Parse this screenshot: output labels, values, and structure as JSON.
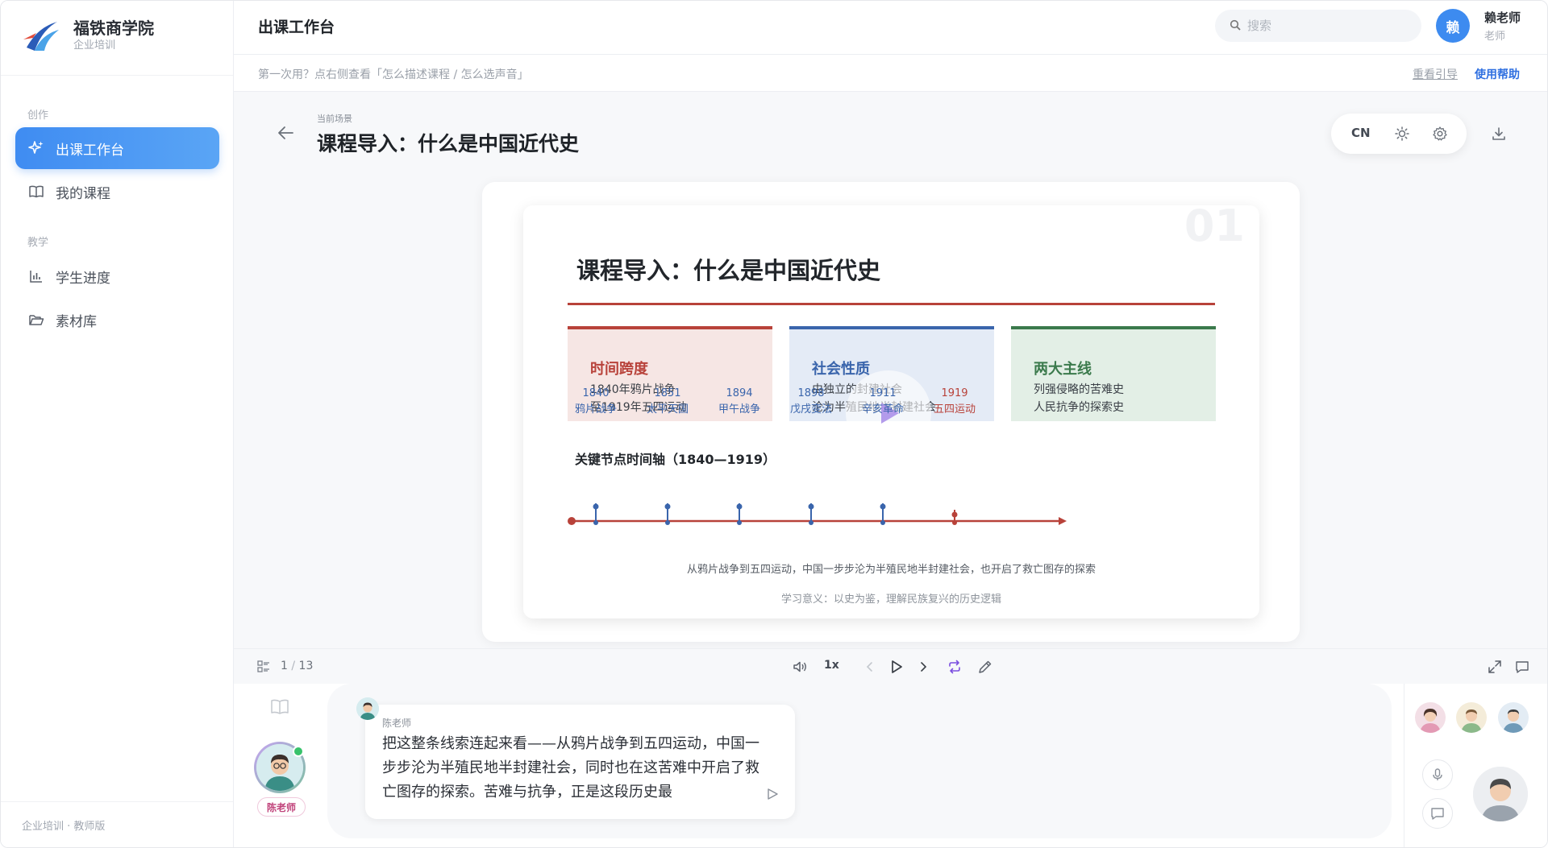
{
  "brand": {
    "name": "福铁商学院",
    "subtitle": "企业培训"
  },
  "sidebar": {
    "sections": [
      {
        "label": "创作"
      },
      {
        "label": "教学"
      }
    ],
    "items": [
      {
        "label": "出课工作台",
        "icon": "sparkle-icon",
        "active": true
      },
      {
        "label": "我的课程",
        "icon": "book-icon"
      },
      {
        "label": "学生进度",
        "icon": "bar-chart-icon"
      },
      {
        "label": "素材库",
        "icon": "folder-icon"
      }
    ],
    "footer": "企业培训 · 教师版"
  },
  "header": {
    "title": "出课工作台",
    "search_placeholder": "搜索",
    "user": {
      "avatar_char": "赖",
      "name": "赖老师",
      "role": "老师"
    }
  },
  "hint": {
    "text": "第一次用？点右侧查看「怎么描述课程 / 怎么选声音」",
    "link_guide": "重看引导",
    "link_help": "使用帮助"
  },
  "scene": {
    "label": "当前场景",
    "title": "课程导入：什么是中国近代史",
    "lang": "CN"
  },
  "slide": {
    "number": "01",
    "title": "课程导入：什么是中国近代史",
    "cards": [
      {
        "head": "时间跨度",
        "l1": "1840年鸦片战争",
        "l2": "至1919年五四运动"
      },
      {
        "head": "社会性质",
        "l1": "由独立的封建社会",
        "l2": "沦为半殖民地半封建社会"
      },
      {
        "head": "两大主线",
        "l1": "列强侵略的苦难史",
        "l2": "人民抗争的探索史"
      }
    ],
    "timeline_title": "关键节点时间轴（1840—1919）",
    "timeline": [
      {
        "year": "1840",
        "event": "鸦片战争"
      },
      {
        "year": "1851",
        "event": "太平天国"
      },
      {
        "year": "1894",
        "event": "甲午战争"
      },
      {
        "year": "1898",
        "event": "戊戌变法"
      },
      {
        "year": "1911",
        "event": "辛亥革命"
      },
      {
        "year": "1919",
        "event": "五四运动"
      }
    ],
    "caption": "从鸦片战争到五四运动，中国一步步沦为半殖民地半封建社会，也开启了救亡图存的探索",
    "meaning": "学习意义：以史为鉴，理解民族复兴的历史逻辑"
  },
  "controls": {
    "page_current": "1",
    "page_total": "13",
    "speed": "1x"
  },
  "dialog": {
    "teacher_tag": "陈老师",
    "speaker": "陈老师",
    "message": "把这整条线索连起来看——从鸦片战争到五四运动，中国一步步沦为半殖民地半封建社会，同时也在这苦难中开启了救亡图存的探索。苦难与抗争，正是这段历史最"
  },
  "colors": {
    "accent": "#3f8cf2",
    "red": "#b8423a",
    "blue": "#3a65ac",
    "green": "#3b7a4c"
  }
}
